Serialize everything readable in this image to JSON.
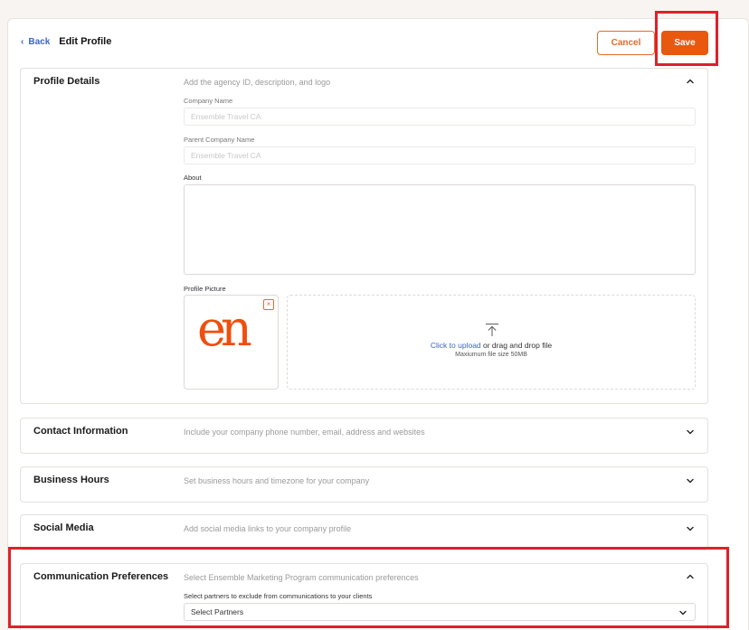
{
  "header": {
    "back_label": "Back",
    "page_title": "Edit Profile",
    "cancel_label": "Cancel",
    "save_label": "Save"
  },
  "sections": {
    "profile": {
      "title": "Profile Details",
      "description": "Add the agency ID, description, and logo",
      "company_name_label": "Company Name",
      "company_name_placeholder": "Ensemble Travel CA",
      "parent_company_label": "Parent Company Name",
      "parent_company_placeholder": "Ensemble Travel CA",
      "about_label": "About",
      "about_value": "",
      "profile_picture_label": "Profile Picture",
      "remove_label": "×",
      "upload_link": "Click to upload",
      "upload_rest": " or drag and drop file",
      "upload_hint": "Maxiumum file size 50MB",
      "logo_text": "en"
    },
    "contact": {
      "title": "Contact Information",
      "description": "Include your company phone number, email, address and websites"
    },
    "hours": {
      "title": "Business Hours",
      "description": "Set business hours and timezone for your company"
    },
    "social": {
      "title": "Social Media",
      "description": "Add social media links to your company profile"
    },
    "communication": {
      "title": "Communication Preferences",
      "description": "Select Ensemble Marketing Program communication preferences",
      "partners_label": "Select partners to exclude from communications to your clients",
      "partners_selected": "Select Partners"
    }
  },
  "colors": {
    "accent": "#e8590f",
    "link": "#3c67c8",
    "highlight": "#e0202a"
  },
  "icons": {
    "back": "chevron-left-icon",
    "collapse": "chevron-up-icon",
    "expand": "chevron-down-icon",
    "upload": "upload-icon",
    "remove": "close-icon"
  }
}
